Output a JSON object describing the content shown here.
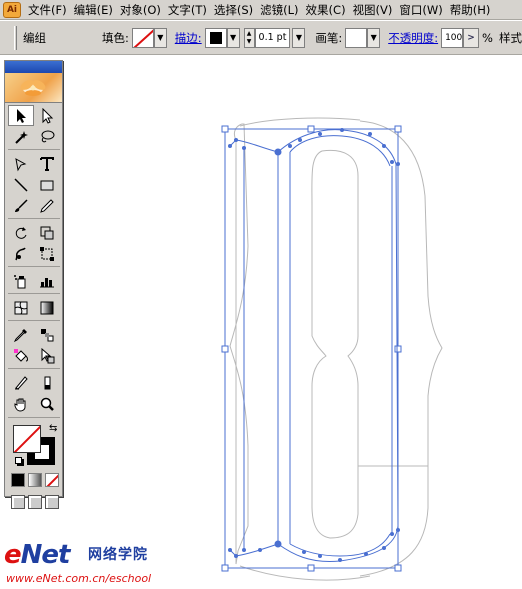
{
  "menubar": {
    "app_icon": "illustrator-app-icon",
    "items": [
      "文件(F)",
      "编辑(E)",
      "对象(O)",
      "文字(T)",
      "选择(S)",
      "滤镜(L)",
      "效果(C)",
      "视图(V)",
      "窗口(W)",
      "帮助(H)"
    ]
  },
  "control": {
    "selection_label": "编组",
    "fill_label": "填色:",
    "stroke_label": "描边:",
    "stroke_weight": "0.1 pt",
    "brush_label": "画笔:",
    "opacity_label": "不透明度:",
    "opacity_value": "100",
    "percent": "%",
    "style_label": "样式"
  },
  "toolbox": {
    "tools": [
      "selection-arrow-icon",
      "direct-selection-icon",
      "magic-wand-icon",
      "lasso-icon",
      "pen-icon",
      "type-icon",
      "line-segment-icon",
      "rectangle-icon",
      "paintbrush-icon",
      "pencil-icon",
      "rotate-icon",
      "scale-icon",
      "warp-icon",
      "free-transform-icon",
      "symbol-sprayer-icon",
      "column-graph-icon",
      "mesh-icon",
      "gradient-icon",
      "eyedropper-icon",
      "blend-icon",
      "live-paint-bucket-icon",
      "live-paint-selection-icon",
      "slice-icon",
      "eraser-icon",
      "hand-icon",
      "zoom-icon"
    ],
    "fill": "none",
    "stroke": "#000000"
  },
  "watermark": {
    "logo_e": "e",
    "logo_rest": "Net",
    "chinese": "网络学院",
    "url": "www.eNet.com.cn/eschool"
  },
  "colors": {
    "selection": "#4a6fd1",
    "outline": "#b8b8b8",
    "chrome": "#d6d3ce"
  }
}
